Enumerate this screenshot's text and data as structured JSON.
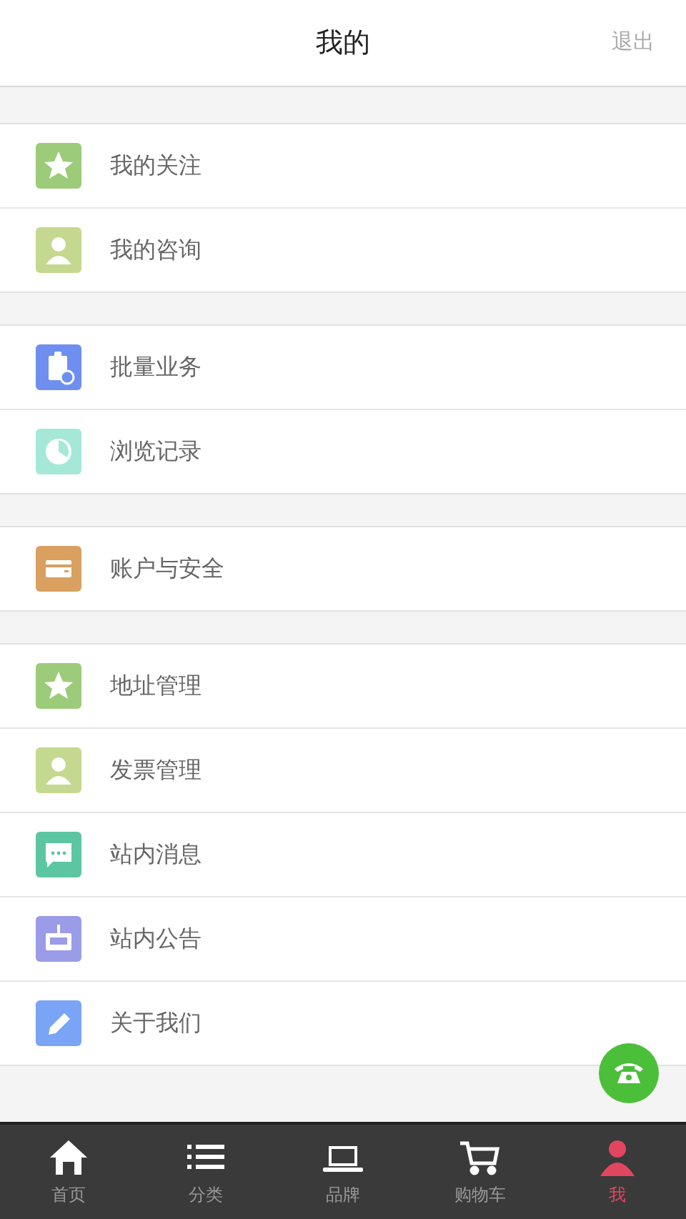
{
  "header": {
    "title": "我的",
    "logout": "退出"
  },
  "groups": [
    {
      "items": [
        {
          "label": "我的关注"
        },
        {
          "label": "我的咨询"
        }
      ]
    },
    {
      "items": [
        {
          "label": "批量业务"
        },
        {
          "label": "浏览记录"
        }
      ]
    },
    {
      "items": [
        {
          "label": "账户与安全"
        }
      ]
    },
    {
      "items": [
        {
          "label": "地址管理"
        },
        {
          "label": "发票管理"
        },
        {
          "label": "站内消息"
        },
        {
          "label": "站内公告"
        },
        {
          "label": "关于我们"
        }
      ]
    }
  ],
  "tabs": [
    {
      "label": "首页",
      "selected": false
    },
    {
      "label": "分类",
      "selected": false
    },
    {
      "label": "品牌",
      "selected": false
    },
    {
      "label": "购物车",
      "selected": false
    },
    {
      "label": "我",
      "selected": true
    }
  ]
}
